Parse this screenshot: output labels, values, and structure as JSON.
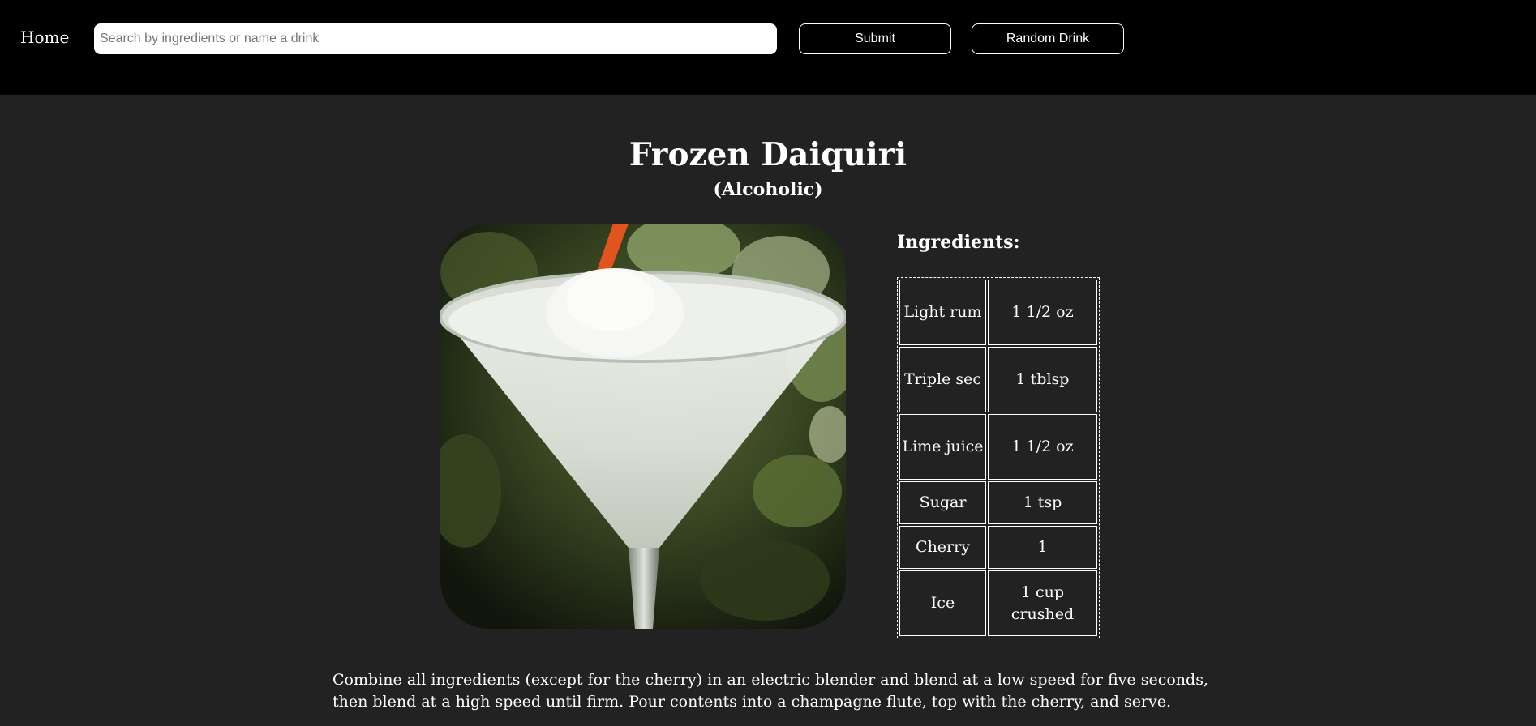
{
  "nav": {
    "home_label": "Home",
    "search_placeholder": "Search by ingredients or name a drink",
    "search_value": "",
    "submit_label": "Submit",
    "random_label": "Random Drink"
  },
  "drink": {
    "name": "Frozen Daiquiri",
    "category": "(Alcoholic)",
    "ingredients_heading": "Ingredients:",
    "ingredients": [
      {
        "name": "Light rum",
        "measure": "1 1/2 oz"
      },
      {
        "name": "Triple sec",
        "measure": "1 tblsp"
      },
      {
        "name": "Lime juice",
        "measure": "1 1/2 oz"
      },
      {
        "name": "Sugar",
        "measure": "1 tsp"
      },
      {
        "name": "Cherry",
        "measure": "1"
      },
      {
        "name": "Ice",
        "measure": "1 cup crushed"
      }
    ],
    "instructions": "Combine all ingredients (except for the cherry) in an electric blender and blend at a low speed for five seconds, then blend at a high speed until firm. Pour contents into a champagne flute, top with the cherry, and serve."
  },
  "colors": {
    "page_background": "#222222",
    "header_background": "#000000",
    "text": "#ffffff",
    "straw": "#e2541f"
  }
}
